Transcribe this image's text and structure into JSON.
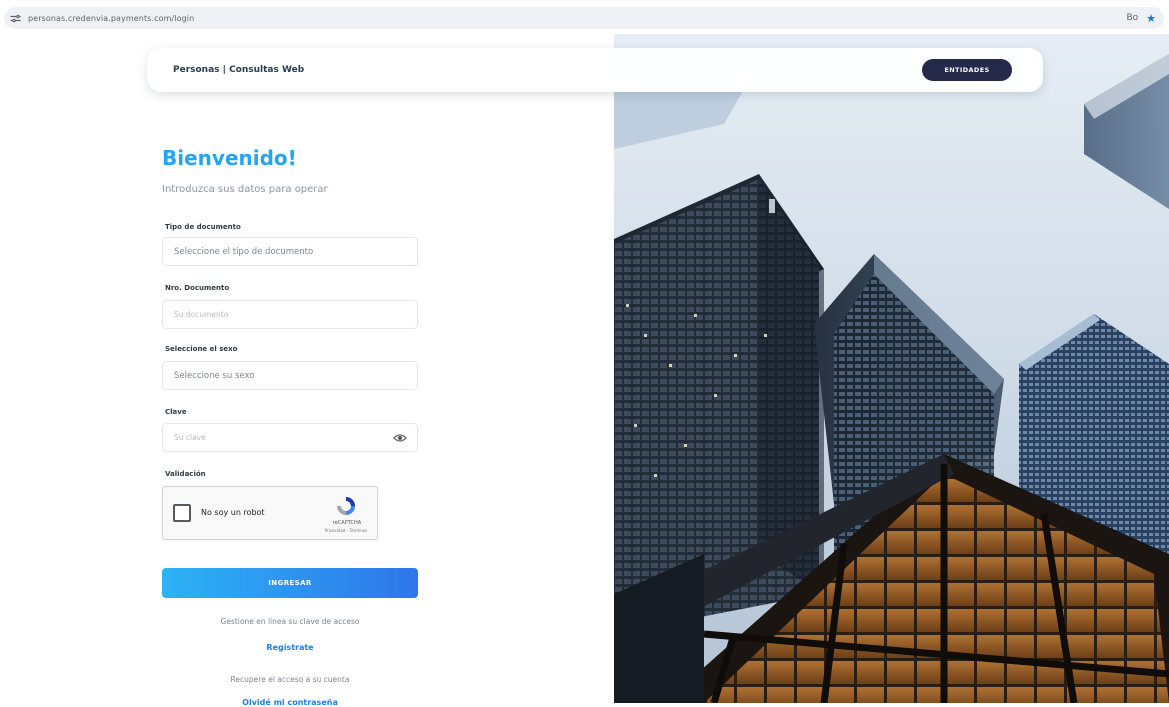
{
  "browser": {
    "url": "personas.credenvia.payments.com/login",
    "profile_label": "Bo",
    "star_icon": "star-icon"
  },
  "header": {
    "brand": "Personas | Consultas Web",
    "entidades_label": "ENTIDADES"
  },
  "form": {
    "title": "Bienvenido!",
    "subtitle": "Introduzca sus datos para operar",
    "tipo_documento": {
      "label": "Tipo de documento",
      "value": "Seleccione el tipo de documento"
    },
    "nro_documento": {
      "label": "Nro. Documento",
      "placeholder": "Su documento"
    },
    "sexo": {
      "label": "Seleccione el sexo",
      "value": "Seleccione su sexo"
    },
    "clave": {
      "label": "Clave",
      "placeholder": "Su clave"
    },
    "validacion": {
      "label": "Validación",
      "captcha_label": "No soy un robot",
      "captcha_brand": "reCAPTCHA",
      "captcha_terms": "Privacidad - Términos"
    },
    "submit_label": "INGRESAR",
    "register_help": "Gestione en línea su clave de acceso",
    "register_link": "Regístrate",
    "recover_help": "Recupere el acceso a su cuenta",
    "recover_link": "Olvidé mi contraseña"
  },
  "colors": {
    "accent": "#26a4f0",
    "button_start": "#2cb3f5",
    "button_end": "#2e76ea",
    "nav_button": "#252a4a",
    "link": "#1a7fe6"
  }
}
